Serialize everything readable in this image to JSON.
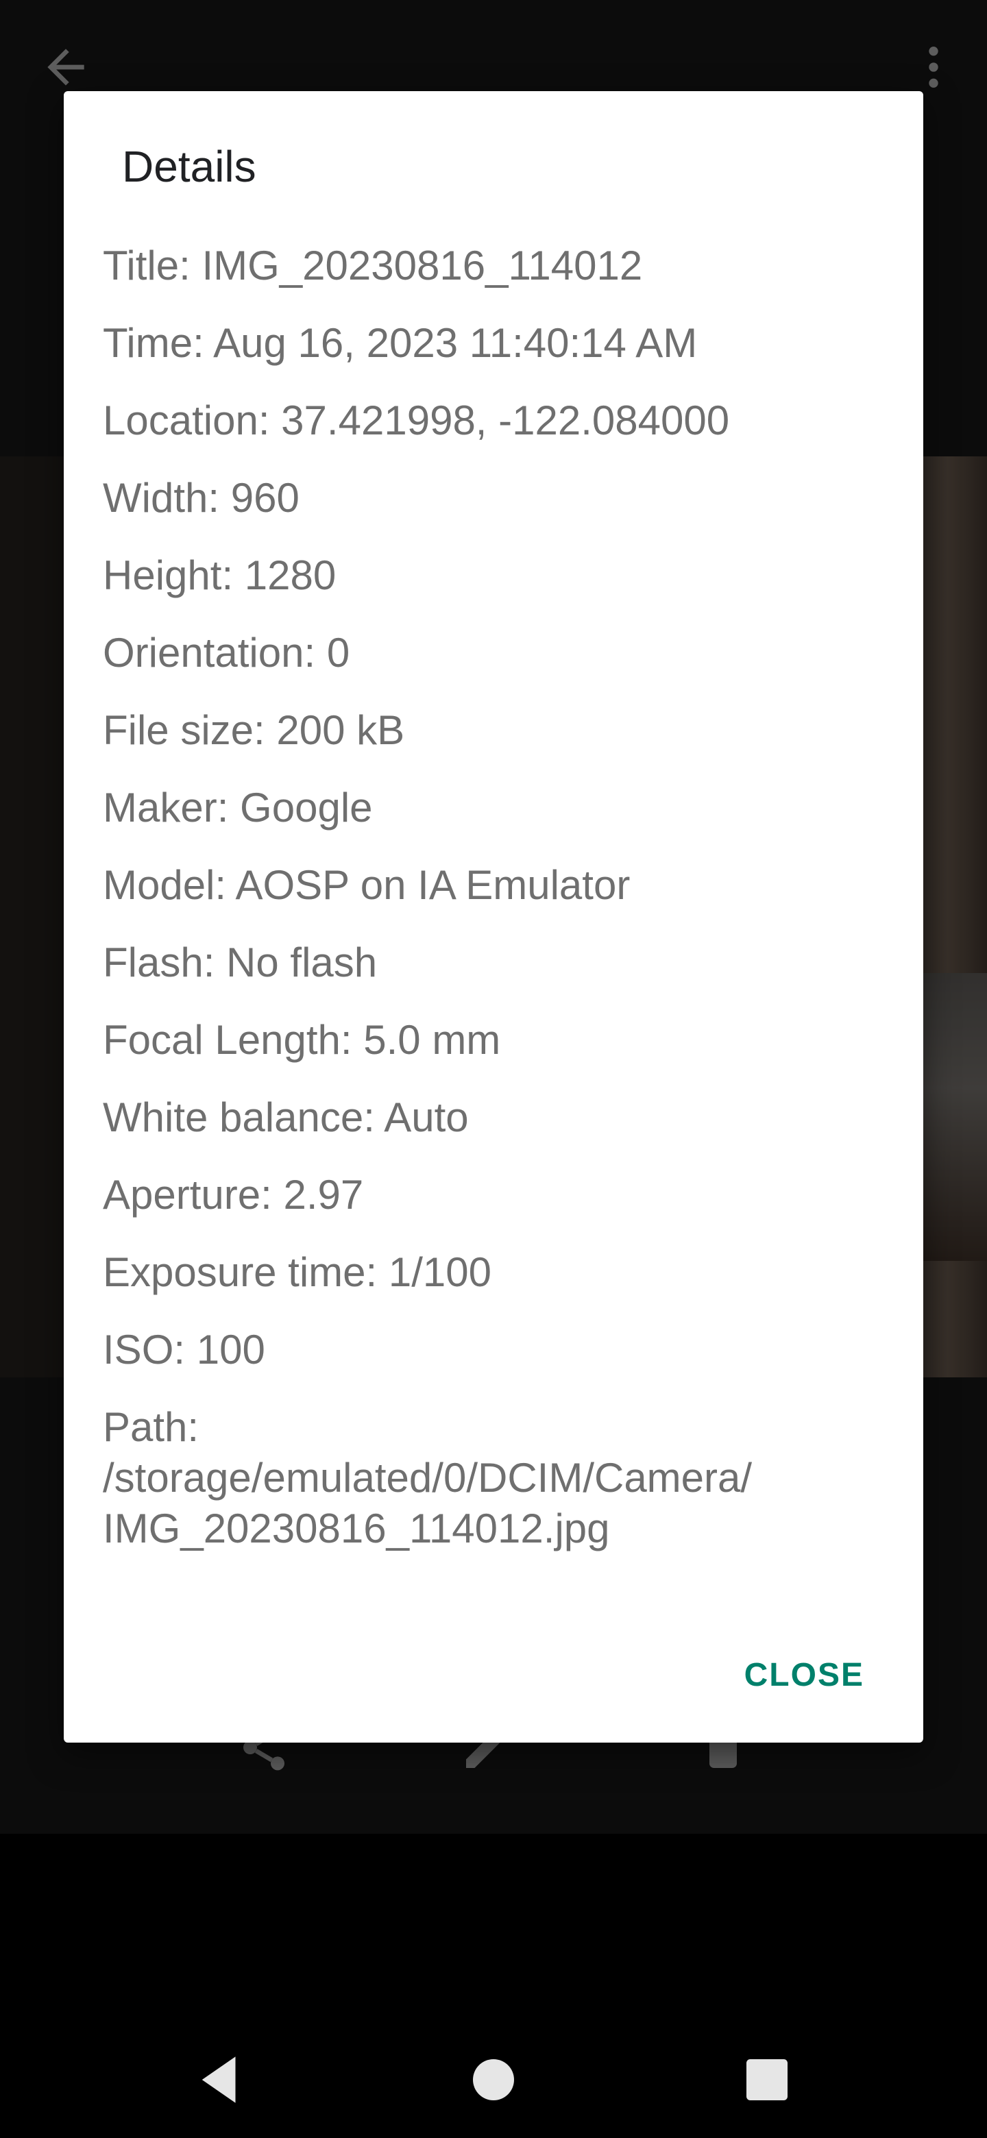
{
  "background": {
    "icons": [
      "back-arrow-icon",
      "more-vert-icon",
      "share-icon",
      "edit-icon",
      "delete-icon"
    ]
  },
  "dialog": {
    "title": "Details",
    "items": [
      "Title: IMG_20230816_114012",
      "Time: Aug 16, 2023 11:40:14 AM",
      "Location: 37.421998, -122.084000",
      "Width: 960",
      "Height: 1280",
      "Orientation: 0",
      "File size: 200 kB",
      "Maker: Google",
      "Model: AOSP on IA Emulator",
      "Flash: No flash",
      "Focal Length: 5.0 mm",
      "White balance: Auto",
      "Aperture: 2.97",
      "Exposure time: 1/100",
      "ISO: 100"
    ],
    "path": {
      "label": "Path:",
      "line1": "/storage/emulated/0/DCIM/Camera/",
      "line2": "IMG_20230816_114012.jpg"
    },
    "close_label": "CLOSE",
    "accent_color": "#00806b"
  },
  "nav": {
    "icons": [
      "nav-back-icon",
      "nav-home-icon",
      "nav-recents-icon"
    ]
  }
}
